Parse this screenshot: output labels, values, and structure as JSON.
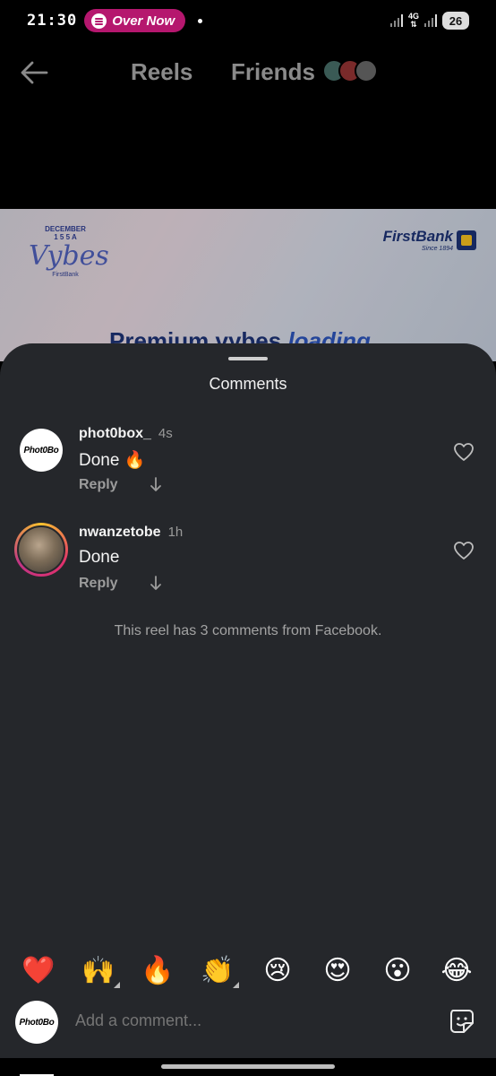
{
  "status_bar": {
    "time": "21:30",
    "now_playing": "Over Now",
    "network": "4G",
    "battery": "26"
  },
  "top_nav": {
    "tabs": [
      {
        "label": "Reels"
      },
      {
        "label": "Friends"
      }
    ]
  },
  "video": {
    "logo_top": "DECEMBER",
    "logo_year": "1 5 5 A",
    "logo_main": "Vybes",
    "logo_sub": "FirstBank",
    "brand_name": "FirstBank",
    "brand_since": "Since 1894",
    "headline_prefix": "Premium vybes ",
    "headline_emph": "loading"
  },
  "comments_sheet": {
    "title": "Comments",
    "comments": [
      {
        "username": "phot0box_",
        "age": "4s",
        "text": "Done 🔥",
        "reply_label": "Reply",
        "avatar_text": "Phot0Bo"
      },
      {
        "username": "nwanzetobe",
        "age": "1h",
        "text": "Done",
        "reply_label": "Reply"
      }
    ],
    "facebook_note": "This reel has 3 comments from Facebook.",
    "quick_reactions": [
      "❤️",
      "🙌",
      "🔥",
      "👏",
      "😢",
      "😍",
      "😮",
      "😂"
    ],
    "input_placeholder": "Add a comment...",
    "my_avatar_text": "Phot0Bo"
  }
}
